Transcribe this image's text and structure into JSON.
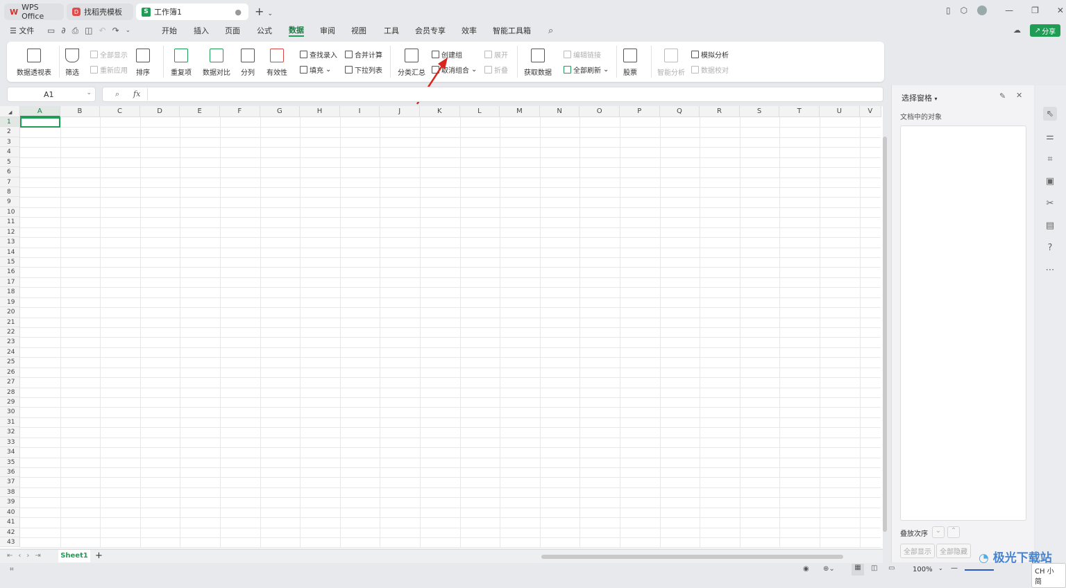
{
  "tabs": [
    {
      "label": "WPS Office",
      "icon": "wps-logo-icon",
      "color": "#d0312d"
    },
    {
      "label": "找稻壳模板",
      "icon": "docer-icon",
      "color": "#e04a4a"
    },
    {
      "label": "工作簿1",
      "icon": "spreadsheet-icon",
      "color": "#1f9d55",
      "active": true
    }
  ],
  "menu": {
    "file": "文件",
    "items": [
      "开始",
      "插入",
      "页面",
      "公式",
      "数据",
      "审阅",
      "视图",
      "工具",
      "会员专享",
      "效率",
      "智能工具箱"
    ],
    "active": "数据",
    "share": "分享"
  },
  "ribbon": {
    "pivot": "数据透视表",
    "filter": "筛选",
    "show_all": "全部显示",
    "reapply": "重新应用",
    "sort": "排序",
    "duplicates": "重复项",
    "compare": "数据对比",
    "split": "分列",
    "validity": "有效性",
    "lookup": "查找录入",
    "fill": "填充",
    "consolidate": "合并计算",
    "dropdown": "下拉列表",
    "subtotal": "分类汇总",
    "create_group": "创建组",
    "ungroup": "取消组合",
    "expand": "展开",
    "collapse": "折叠",
    "get_data": "获取数据",
    "edit_links": "编辑链接",
    "refresh_all": "全部刷新",
    "stocks": "股票",
    "smart_analysis": "智能分析",
    "what_if": "模拟分析",
    "data_check": "数据校对"
  },
  "formula": {
    "name_box": "A1",
    "fx": "fx",
    "value": ""
  },
  "grid": {
    "columns": [
      "A",
      "B",
      "C",
      "D",
      "E",
      "F",
      "G",
      "H",
      "I",
      "J",
      "K",
      "L",
      "M",
      "N",
      "O",
      "P",
      "Q",
      "R",
      "S",
      "T",
      "U",
      "V"
    ],
    "row_count": 43,
    "selected": "A1",
    "accent": "#1f9d55"
  },
  "sheets": {
    "tabs": [
      "Sheet1"
    ],
    "active": "Sheet1",
    "add": "+"
  },
  "panel": {
    "title": "选择窗格",
    "subtitle": "文档中的对象",
    "order": "叠放次序",
    "show_all": "全部显示",
    "hide_all": "全部隐藏"
  },
  "status": {
    "zoom": "100%",
    "ime": "CH 小 简"
  },
  "watermark": "极光下载站"
}
